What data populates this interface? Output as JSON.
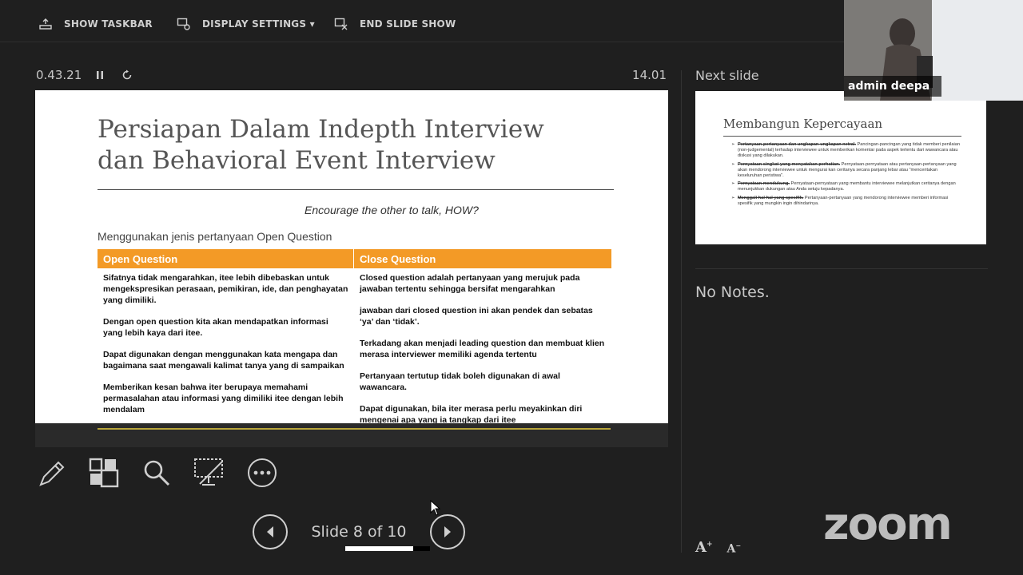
{
  "toolbar": {
    "show_taskbar": "SHOW TASKBAR",
    "display_settings": "DISPLAY SETTINGS ▾",
    "end_slide_show": "END SLIDE SHOW"
  },
  "timer": {
    "elapsed": "0.43.21",
    "clock": "14.01"
  },
  "slide": {
    "title_line1": "Persiapan Dalam Indepth Interview",
    "title_line2": "dan Behavioral Event Interview",
    "encourage": "Encourage the other to talk, HOW?",
    "subtitle": "Menggunakan jenis pertanyaan Open Question",
    "table": {
      "headers": [
        "Open Question",
        "Close Question"
      ],
      "open": [
        "Sifatnya tidak mengarahkan, itee lebih dibebaskan untuk mengekspresikan perasaan, pemikiran, ide, dan penghayatan yang dimiliki.",
        "Dengan open question kita akan mendapatkan informasi yang lebih kaya dari itee.",
        "Dapat digunakan dengan menggunakan kata mengapa dan bagaimana saat mengawali kalimat tanya yang di sampaikan",
        "Memberikan kesan bahwa iter berupaya memahami permasalahan atau informasi yang dimiliki itee dengan lebih mendalam"
      ],
      "close": [
        "Closed question adalah pertanyaan yang merujuk pada jawaban tertentu sehingga bersifat mengarahkan",
        "jawaban dari closed question ini akan pendek dan sebatas ‘ya’ dan ‘tidak’.",
        "Terkadang akan menjadi leading question dan membuat klien merasa interviewer memiliki agenda tertentu",
        "Pertanyaan tertutup tidak boleh digunakan di awal wawancara.",
        "Dapat digunakan, bila iter merasa perlu meyakinkan diri mengenai apa yang ia tangkap dari itee"
      ]
    }
  },
  "next_slide": {
    "label": "Next slide",
    "title": "Membangun Kepercayaan",
    "items": [
      {
        "term": "Pertanyaan-pertanyaan dan ungkapan-ungkapan netral.",
        "text": " Pancingan-pancingan yang tidak memberi penilaian (non-judgemental) terhadap interviewee untuk memberikan komentar pada aspek tertentu dari wawancara atau diskusi yang dilakukan."
      },
      {
        "term": "Pernyataan singkat yang menyatakan perhatian.",
        "text": " Pernyataan-pernyataan atau pertanyaan-pertanyaan yang akan mendorong interviewee untuk mengurai kan ceritanya secara panjang lebar atau \"menceritakan keseluruhan peristiwa\"."
      },
      {
        "term": "Pernyataan mendukung.",
        "text": " Pernyataan-pernyataan yang membantu interviewee melanjutkan ceritanya dengan menunjukkan dukungan atau Anda setuju kepadanya."
      },
      {
        "term": "Menggali hal-hal yang spesifik.",
        "text": " Pertanyaan-pertanyaan yang mendorong interviewee memberi informasi spesifik yang mungkin ingin dihindarinya."
      }
    ]
  },
  "notes": "No Notes.",
  "navigation": {
    "slide_count": "Slide 8 of 10",
    "progress": 0.8
  },
  "participant": {
    "name": "admin deepa ..."
  },
  "brand": {
    "logo": "zoom"
  },
  "font_controls": {
    "increase": "A",
    "decrease": "A"
  }
}
